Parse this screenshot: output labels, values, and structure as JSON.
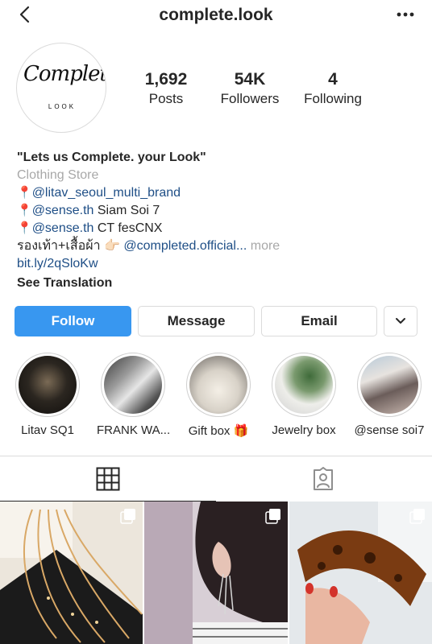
{
  "header": {
    "username": "complete.look"
  },
  "profile": {
    "avatar_script": "Complete.",
    "avatar_subtext": "LOOK",
    "stats": [
      {
        "value": "1,692",
        "label": "Posts"
      },
      {
        "value": "54K",
        "label": "Followers"
      },
      {
        "value": "4",
        "label": "Following"
      }
    ]
  },
  "bio": {
    "name": "\"Lets us Complete. your Look\"",
    "category": "Clothing Store",
    "pin_icon": "📍",
    "line1_link": "@litav_seoul_multi_brand",
    "line2_link": "@sense.th",
    "line2_text": " Siam Soi 7",
    "line3_link": "@sense.th",
    "line3_text": " CT fesCNX",
    "line4_text": "รองเท้า+เสื้อผ้า ",
    "line4_emoji": "👉🏻",
    "line4_link": " @completed.official...",
    "more": " more",
    "url": "bit.ly/2qSloKw",
    "see_translation": "See Translation"
  },
  "actions": {
    "follow": "Follow",
    "message": "Message",
    "email": "Email"
  },
  "highlights": [
    {
      "label": "Litav SQ1"
    },
    {
      "label": "FRANK WA..."
    },
    {
      "label": "Gift box 🎁"
    },
    {
      "label": "Jewelry box"
    },
    {
      "label": "@sense soi7"
    }
  ],
  "colors": {
    "accent": "#3897f0",
    "link": "#1e4e86",
    "muted": "#a8a8a8",
    "border": "#dbdbdb"
  },
  "icons": [
    "back-chevron-icon",
    "more-options-icon",
    "grid-icon",
    "tagged-icon",
    "multi-post-icon"
  ]
}
